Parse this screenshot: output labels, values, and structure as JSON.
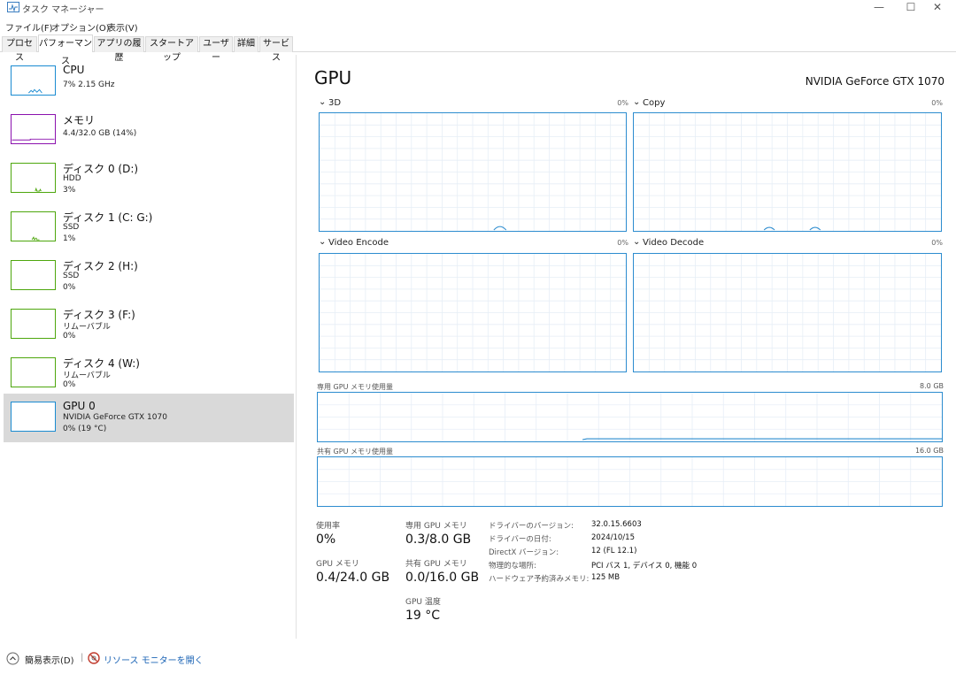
{
  "window": {
    "title": "タスク マネージャー",
    "minimize_glyph": "—",
    "maximize_glyph": "☐",
    "close_glyph": "✕",
    "icon": "task-manager-icon"
  },
  "menu": [
    "ファイル(F)",
    "オプション(O)",
    "表示(V)"
  ],
  "tabs": [
    {
      "label": "プロセス",
      "active": false
    },
    {
      "label": "パフォーマンス",
      "active": true
    },
    {
      "label": "アプリの履歴",
      "active": false
    },
    {
      "label": "スタートアップ",
      "active": false
    },
    {
      "label": "ユーザー",
      "active": false
    },
    {
      "label": "詳細",
      "active": false
    },
    {
      "label": "サービス",
      "active": false
    }
  ],
  "sidebar": {
    "items": [
      {
        "name": "CPU",
        "sub1": "7%  2.15 GHz",
        "sub2": "",
        "color": "#1a8bd1"
      },
      {
        "name": "メモリ",
        "sub1": "4.4/32.0 GB (14%)",
        "sub2": "",
        "color": "#8b12ae"
      },
      {
        "name": "ディスク 0 (D:)",
        "sub1": "HDD",
        "sub2": "3%",
        "color": "#4da60c"
      },
      {
        "name": "ディスク 1 (C: G:)",
        "sub1": "SSD",
        "sub2": "1%",
        "color": "#4da60c"
      },
      {
        "name": "ディスク 2 (H:)",
        "sub1": "SSD",
        "sub2": "0%",
        "color": "#4da60c"
      },
      {
        "name": "ディスク 3 (F:)",
        "sub1": "リムーバブル",
        "sub2": "0%",
        "color": "#4da60c"
      },
      {
        "name": "ディスク 4 (W:)",
        "sub1": "リムーバブル",
        "sub2": "0%",
        "color": "#4da60c"
      },
      {
        "name": "GPU 0",
        "sub1": "NVIDIA GeForce GTX 1070",
        "sub2": "0%  (19 °C)",
        "color": "#1a8bd1"
      }
    ]
  },
  "main": {
    "title": "GPU",
    "model": "NVIDIA GeForce GTX 1070",
    "graphs": [
      {
        "label": "3D",
        "pct": "0%"
      },
      {
        "label": "Copy",
        "pct": "0%"
      },
      {
        "label": "Video Encode",
        "pct": "0%"
      },
      {
        "label": "Video Decode",
        "pct": "0%"
      }
    ],
    "dedicated_mem_label": "専用 GPU メモリ使用量",
    "dedicated_mem_max": "8.0 GB",
    "shared_mem_label": "共有 GPU メモリ使用量",
    "shared_mem_max": "16.0 GB",
    "chevron": "⌄"
  },
  "stats": {
    "usage_label": "使用率",
    "usage_value": "0%",
    "gpu_mem_label": "GPU メモリ",
    "gpu_mem_value": "0.4/24.0 GB",
    "dedicated_label": "専用 GPU メモリ",
    "dedicated_value": "0.3/8.0 GB",
    "shared_label": "共有 GPU メモリ",
    "shared_value": "0.0/16.0 GB",
    "temp_label": "GPU 温度",
    "temp_value": "19 °C"
  },
  "details": [
    {
      "key": "ドライバーのバージョン:",
      "value": "32.0.15.6603"
    },
    {
      "key": "ドライバーの日付:",
      "value": "2024/10/15"
    },
    {
      "key": "DirectX バージョン:",
      "value": "12 (FL 12.1)"
    },
    {
      "key": "物理的な場所:",
      "value": "PCI バス 1, デバイス 0, 機能 0"
    },
    {
      "key": "ハードウェア予約済みメモリ:",
      "value": "125 MB"
    }
  ],
  "footer": {
    "fewer_details": "簡易表示(D)",
    "separator": "|",
    "resource_monitor": "リソース モニターを開く"
  },
  "colors": {
    "accent": "#2c8ccf",
    "grid": "#e6eef6",
    "link": "#1a63b5"
  }
}
